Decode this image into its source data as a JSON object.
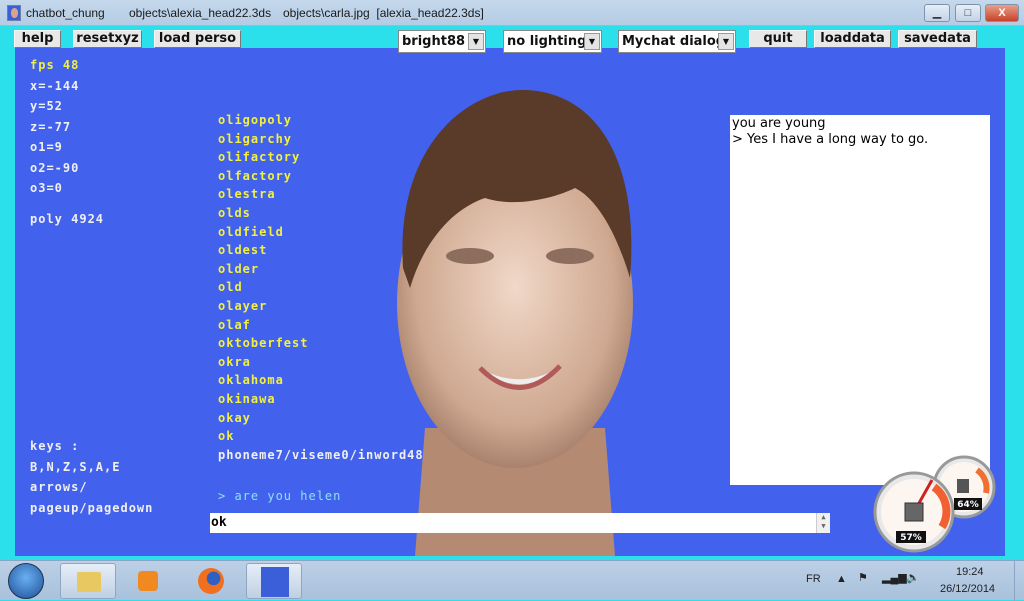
{
  "window": {
    "title": "chatbot_chung",
    "object_file": "objects\\alexia_head22.3ds",
    "texture": "objects\\carla.jpg  [alexia_head22.3ds]",
    "min": "▁",
    "max": "□",
    "close": "X"
  },
  "toolbar": {
    "help": "help",
    "resetxyz": "resetxyz",
    "load_perso": "load perso",
    "brightness": "bright88",
    "lighting": "no lighting",
    "dialog": "Mychat dialog",
    "quit": "quit",
    "loaddata": "loaddata",
    "savedata": "savedata"
  },
  "stats": {
    "fps": "fps 48",
    "x": "x=-144",
    "y": "y=52",
    "z": "z=-77",
    "o1": "o1=9",
    "o2": "o2=-90",
    "o3": "o3=0",
    "poly": "poly 4924"
  },
  "keys": {
    "title": "keys :",
    "line1": "B,N,Z,S,A,E",
    "line2": "arrows/",
    "line3": "pageup/pagedown"
  },
  "words": [
    "oligopoly",
    "oligarchy",
    "olifactory",
    "olfactory",
    "olestra",
    "olds",
    "oldfield",
    "oldest",
    "older",
    "old",
    "olayer",
    "olaf",
    "oktoberfest",
    "okra",
    "oklahoma",
    "okinawa",
    "okay",
    "ok"
  ],
  "phoneme": "phoneme7/viseme0/inword48",
  "last_prompt": "> are you helen",
  "input_value": "ok",
  "chat": {
    "line1": "you are young",
    "line2": "> Yes I have a long way to go."
  },
  "gadget": {
    "cpu": "57%",
    "mem": "64%"
  },
  "taskbar": {
    "lang": "FR",
    "time": "19:24",
    "date": "26/12/2014"
  }
}
